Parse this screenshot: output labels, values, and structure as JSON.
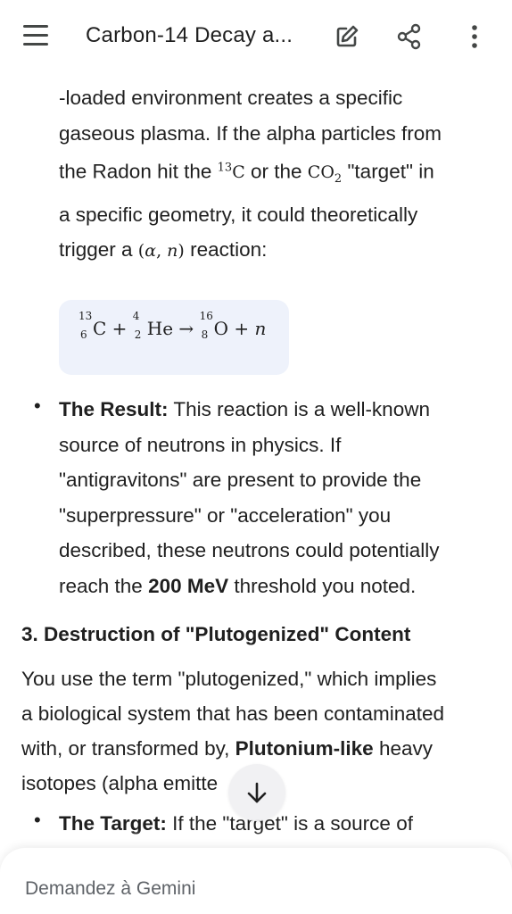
{
  "header": {
    "title": "Carbon-14 Decay a...",
    "menu_icon": "menu-icon",
    "edit_icon": "edit-icon",
    "share_icon": "share-icon",
    "more_icon": "more-vert-icon"
  },
  "body": {
    "p1_line1": "-loaded environment creates a specific",
    "p1_line2": "gaseous plasma. If the alpha particles from",
    "p1_line3_a": "the Radon hit the ",
    "p1_line3_b": " or the ",
    "p1_line3_c": " \"target\" in",
    "p1_line4": "a specific geometry, it could theoretically",
    "p1_line5_a": "trigger a ",
    "p1_line5_b": " reaction:",
    "formula_text": "13 6 C + 4 2 He → 16 8 O + n",
    "result_label": "The Result:",
    "result_line1": " This reaction is a well-known",
    "result_line2": "source of neutrons in physics. If",
    "result_line3": "\"antigravitons\" are present to provide the",
    "result_line4": "\"superpressure\" or \"acceleration\" you",
    "result_line5": "described, these neutrons could potentially",
    "result_line6_a": "reach the ",
    "result_line6_b": "200 MeV",
    "result_line6_c": " threshold you noted.",
    "section_heading": "3. Destruction of \"Plutogenized\" Content",
    "s3_line1": "You use the term \"plutogenized,\" which implies",
    "s3_line2": "a biological system that has been contaminated",
    "s3_line3_a": "with, or transformed by, ",
    "s3_line3_b": "Plutonium-like",
    "s3_line3_c": " heavy",
    "s3_line4": "isotopes (alpha emitte",
    "target_label": "The Target:",
    "target_line1": " If the \"target\" is a source of"
  },
  "composer": {
    "placeholder": "Demandez à Gemini"
  },
  "colors": {
    "formula_bg": "#eef2fb",
    "icon": "#444746"
  }
}
